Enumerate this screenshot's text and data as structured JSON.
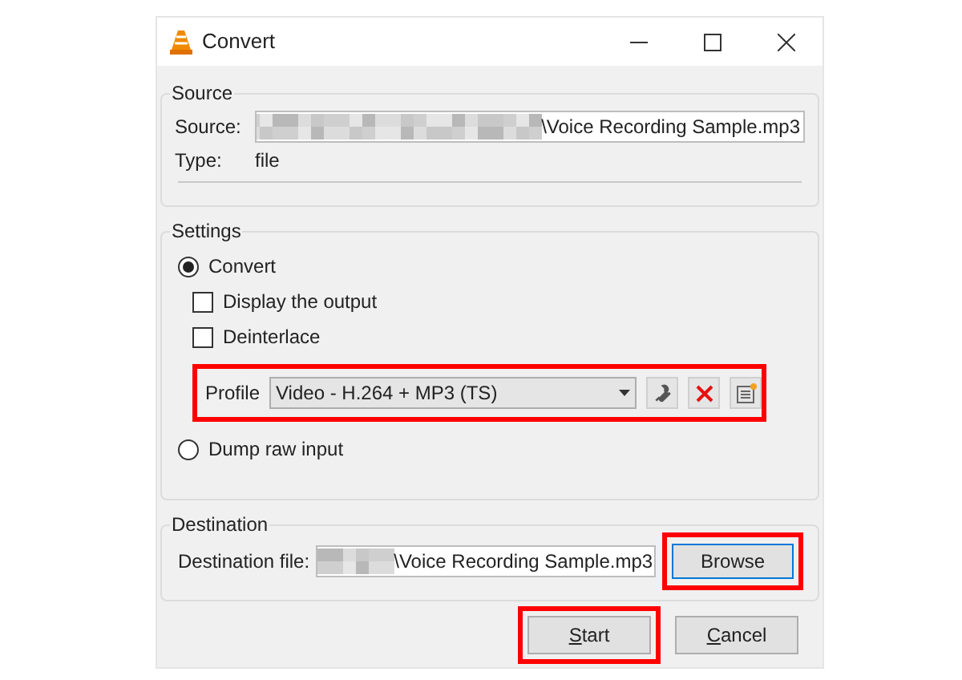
{
  "window": {
    "title": "Convert"
  },
  "source": {
    "title": "Source",
    "source_label": "Source:",
    "source_value": "\\Voice Recording Sample.mp3",
    "type_label": "Type:",
    "type_value": "file"
  },
  "settings": {
    "title": "Settings",
    "options": [
      {
        "kind": "radio",
        "label": "Convert",
        "selected": true
      },
      {
        "kind": "checkbox",
        "label": "Display the output",
        "checked": false
      },
      {
        "kind": "checkbox",
        "label": "Deinterlace",
        "checked": false
      },
      {
        "kind": "profile",
        "label": "Profile",
        "value": "Video - H.264 + MP3 (TS)",
        "highlighted": true
      },
      {
        "kind": "radio",
        "label": "Dump raw input",
        "selected": false
      }
    ]
  },
  "destination": {
    "title": "Destination",
    "label": "Destination file:",
    "value": "\\Voice Recording Sample.mp3",
    "browse": {
      "label": "Browse",
      "highlighted": true,
      "focused": true
    }
  },
  "buttons": [
    {
      "label": "Start",
      "mnemonic": true,
      "highlighted": true
    },
    {
      "label": "Cancel",
      "mnemonic": true,
      "highlighted": false
    }
  ]
}
